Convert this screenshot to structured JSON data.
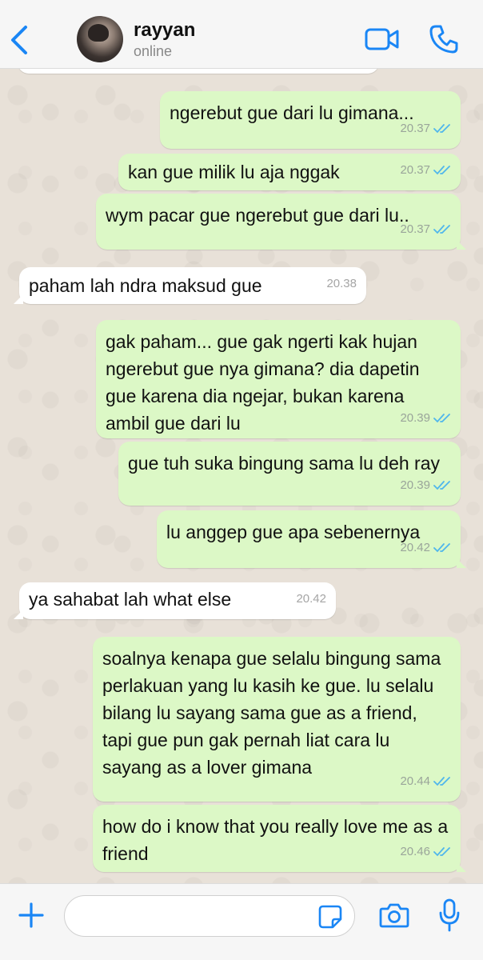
{
  "header": {
    "back_icon": "chevron-left-icon",
    "contact_name": "rayyan",
    "contact_status": "online",
    "video_icon": "video-camera-icon",
    "call_icon": "phone-icon"
  },
  "colors": {
    "accent": "#1a86f5",
    "outgoing_bubble": "#dcf8c6",
    "incoming_bubble": "#ffffff",
    "read_ticks": "#4fb6ec"
  },
  "messages": [
    {
      "direction": "out",
      "text": "ngerebut gue dari lu gimana...",
      "time": "20.37",
      "status": "read"
    },
    {
      "direction": "out",
      "text": "kan gue milik lu aja nggak",
      "time": "20.37",
      "status": "read"
    },
    {
      "direction": "out",
      "text": "wym pacar gue ngerebut gue dari lu..",
      "time": "20.37",
      "status": "read"
    },
    {
      "direction": "in",
      "text": "paham lah ndra maksud gue",
      "time": "20.38"
    },
    {
      "direction": "out",
      "text": "gak paham... gue gak ngerti kak hujan ngerebut gue nya gimana? dia dapetin gue karena dia ngejar, bukan karena ambil gue dari lu",
      "time": "20.39",
      "status": "read"
    },
    {
      "direction": "out",
      "text": "gue tuh suka bingung sama lu deh ray",
      "time": "20.39",
      "status": "read"
    },
    {
      "direction": "out",
      "text": "lu anggep gue apa sebenernya",
      "time": "20.42",
      "status": "read"
    },
    {
      "direction": "in",
      "text": "ya sahabat lah what else",
      "time": "20.42"
    },
    {
      "direction": "out",
      "text": "soalnya kenapa gue selalu bingung sama perlakuan yang lu kasih ke gue. lu selalu bilang lu sayang sama gue as a friend, tapi gue pun gak pernah liat cara lu sayang as a lover gimana",
      "time": "20.44",
      "status": "read"
    },
    {
      "direction": "out",
      "text": "how do i know that you really love me as a friend",
      "time": "20.46",
      "status": "read"
    }
  ],
  "input_bar": {
    "plus_icon": "plus-icon",
    "message_value": "",
    "sticker_icon": "sticker-icon",
    "camera_icon": "camera-icon",
    "mic_icon": "microphone-icon"
  }
}
